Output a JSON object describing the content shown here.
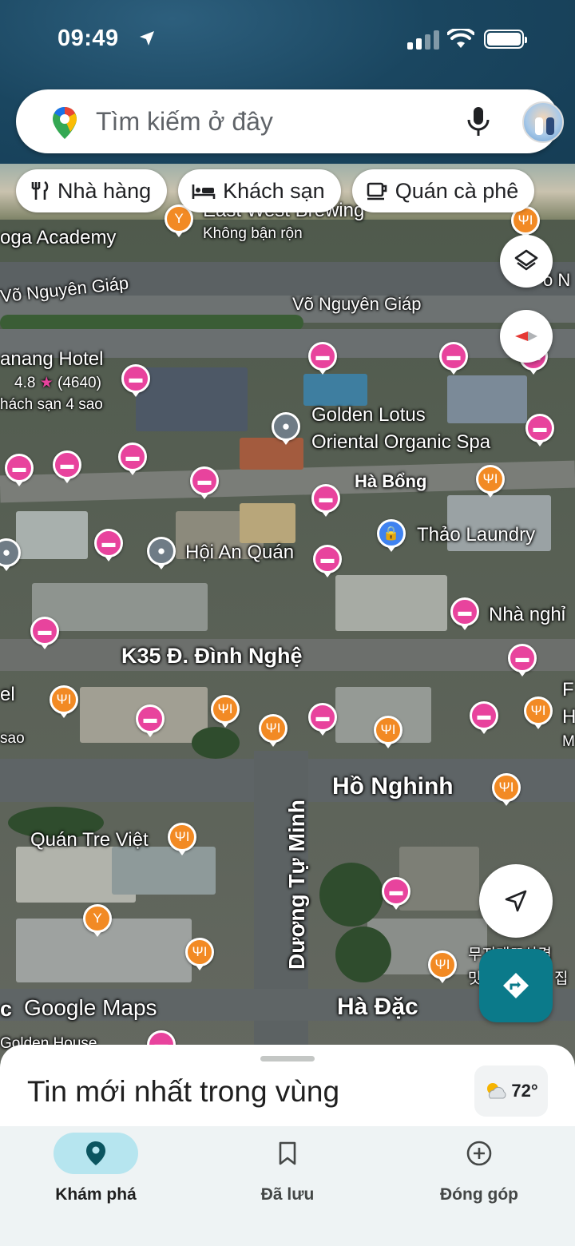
{
  "status_bar": {
    "time": "09:49"
  },
  "search": {
    "placeholder": "Tìm kiếm ở đây"
  },
  "chips": [
    {
      "label": "Nhà hàng",
      "icon": "restaurant-icon"
    },
    {
      "label": "Khách sạn",
      "icon": "hotel-icon"
    },
    {
      "label": "Quán cà phê",
      "icon": "coffee-icon"
    }
  ],
  "map": {
    "labels": {
      "east_west": "East West Brewing",
      "not_busy": "Không bận rộn",
      "yoga": "oga Academy",
      "street_vng_1": "Võ Nguyên Giáp",
      "street_vng_2": "Võ Nguyên Giáp",
      "street_vng_3": "ó N",
      "hotel_name": "anang Hotel",
      "hotel_rating": "4.8",
      "hotel_reviews": "(4640)",
      "hotel_class": "hách sạn 4 sao",
      "spa_1": "Golden Lotus",
      "spa_2": "Oriental Organic Spa",
      "ha_bong": "Hà Bổng",
      "laundry": "Thảo Laundry",
      "hoi_an": "Hội An Quán",
      "nha_nghi": "Nhà nghỉ",
      "k35": "K35 Đ. Đình Nghệ",
      "el": "el",
      "sao": "sao",
      "f_label": "F",
      "h_label": "H",
      "m_label": "M",
      "ho_nghinh": "Hồ Nghinh",
      "quan_tre": "Quán Tre Việt",
      "duong_tu_minh": "Dương Tự Minh",
      "korean_1": "무지개뜨삼겹",
      "korean_2": "맛",
      "korean_3": "집",
      "google_maps": "Google Maps",
      "c_label": "c",
      "ha_dac": "Hà Đặc",
      "golden_house": "Golden House"
    }
  },
  "sheet": {
    "title": "Tin mới nhất trong vùng",
    "weather": "72°"
  },
  "nav": {
    "explore": "Khám phá",
    "saved": "Đã lưu",
    "contribute": "Đóng góp"
  },
  "colors": {
    "hotel_pin": "#e8439d",
    "food_pin": "#f28a24",
    "accent": "#0b7a8a",
    "nav_active": "#b6e5ef"
  }
}
